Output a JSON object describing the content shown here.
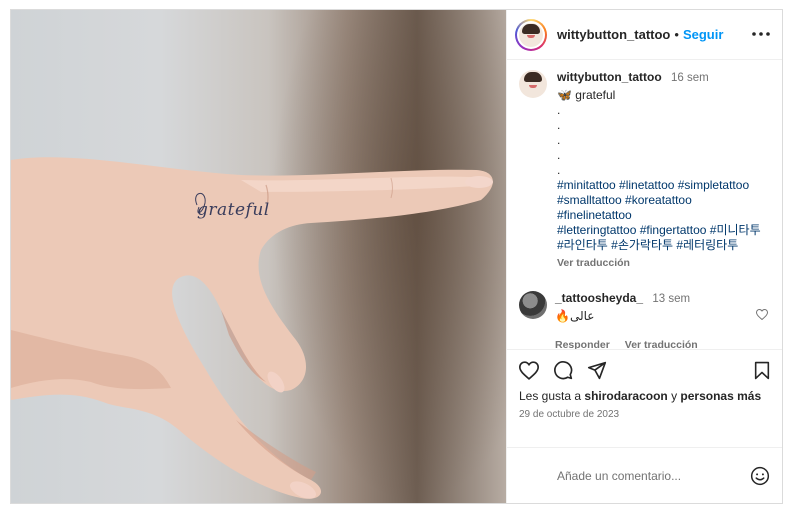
{
  "post": {
    "username": "wittybutton_tattoo",
    "separator": "•",
    "follow_label": "Seguir",
    "more_label": "•••",
    "photo_text": "grateful"
  },
  "caption": {
    "username": "wittybutton_tattoo",
    "time": "16 sem",
    "text": "🦋 grateful",
    "dots": [
      ".",
      ".",
      ".",
      ".",
      "."
    ],
    "hashtags": [
      "#minitattoo #linetattoo #simpletattoo",
      "#smalltattoo #koreatattoo #finelinetattoo",
      "#letteringtattoo #fingertattoo #미니타투",
      "#라인타투 #손가락타투 #레터링타투"
    ],
    "translate_label": "Ver traducción"
  },
  "comment": {
    "username": "_tattoosheyda_",
    "time": "13 sem",
    "text": "🔥عالی",
    "reply_label": "Responder",
    "translate_label": "Ver traducción"
  },
  "actions": {
    "likes_prefix": "Les gusta a ",
    "likes_user": "shirodaracoon",
    "likes_mid": " y ",
    "likes_others": "personas más",
    "date": "29 de octubre de 2023"
  },
  "add_comment": {
    "placeholder": "Añade un comentario..."
  },
  "icons": {
    "like": "heart-icon",
    "comment": "comment-icon",
    "share": "send-icon",
    "save": "bookmark-icon",
    "emoji": "emoji-icon",
    "more": "more-icon"
  },
  "colors": {
    "accent": "#0095f6",
    "hashtag": "#00376b",
    "muted": "#737373"
  }
}
